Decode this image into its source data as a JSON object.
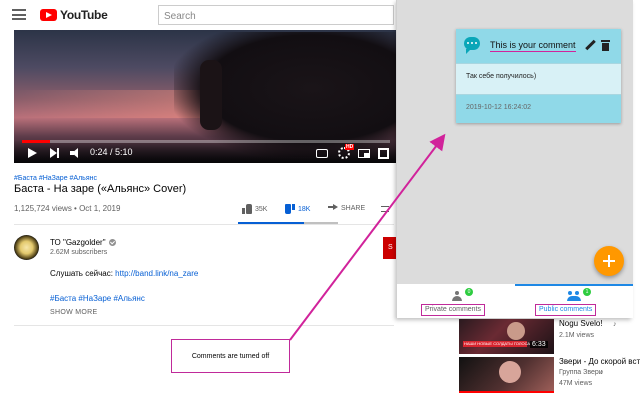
{
  "header": {
    "logo_text": "YouTube",
    "search_placeholder": "Search"
  },
  "player": {
    "time": "0:24 / 5:10",
    "progress_fraction": 0.077,
    "hd_badge": "HD"
  },
  "video": {
    "hashtags": "#Баста #НаЗаре #Альянс",
    "title": "Баста - На заре («Альянс» Cover)",
    "views_date": "1,125,724 views • Oct 1, 2019",
    "likes": "35K",
    "dislikes": "18K",
    "share": "SHARE",
    "like_fraction": 0.66
  },
  "channel": {
    "name": "ТО \"Gazgolder\"",
    "subscribers": "2.62M subscribers",
    "subscribe": "S",
    "desc_prefix": "Слушать сейчас: ",
    "desc_link": "http://band.link/na_zare",
    "desc_tags": "#Баста #НаЗаре #Альянс",
    "show_more": "SHOW MORE"
  },
  "annotation": {
    "left_text": "Comments are turned off"
  },
  "extension": {
    "card_title": "This is your comment",
    "card_text": "Так себе получилось)",
    "card_time": "2019-10-12 16:24:02",
    "private_tab": "Private comments",
    "public_tab": "Public comments",
    "private_count": "0",
    "public_count": "1"
  },
  "sidebar": {
    "items": [
      {
        "title": "Nogu Svelo!",
        "subtitle": "",
        "meta": "2.1M views",
        "duration": "6:33",
        "thumb_caption": "НАШИ НОВЫЕ СОЛДАТЫ ГОЛОСА"
      },
      {
        "title": "Звери - До скорой вст",
        "subtitle": "Группа Звери",
        "meta": "47M views"
      }
    ]
  },
  "colors": {
    "annotation": "#c02a9a",
    "fab": "#ff9800",
    "card": "#90d9e8",
    "accent_blue": "#1e88e5",
    "youtube_red": "#ff0000"
  },
  "icons": [
    "menu-icon",
    "youtube-logo-icon",
    "play-icon",
    "next-icon",
    "volume-icon",
    "captions-icon",
    "settings-icon",
    "miniplayer-icon",
    "fullscreen-icon",
    "like-icon",
    "dislike-icon",
    "share-icon",
    "more-icon",
    "verified-icon",
    "chat-icon",
    "edit-icon",
    "delete-icon",
    "add-icon",
    "person-icon",
    "people-icon"
  ]
}
